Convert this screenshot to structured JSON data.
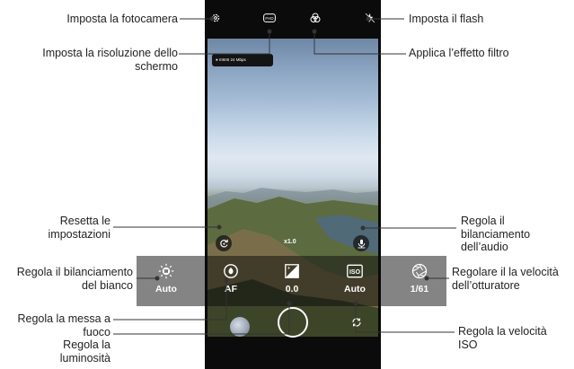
{
  "callouts": {
    "imposta_fotocamera": "Imposta la fotocamera",
    "imposta_risoluzione": "Imposta la risoluzione dello schermo",
    "applica_filtro": "Applica l’effetto filtro",
    "imposta_flash": "Imposta il flash",
    "resetta": "Resetta le impostazioni",
    "bilanciamento_audio": "Regola il bilanciamento dell’audio",
    "bilanciamento_bianco": "Regola il bilanciamento del bianco",
    "velocita_otturatore": "Regolare il la velocità dell’otturatore",
    "messa_a_fuoco": "Regola la messa a fuoco",
    "luminosita": "Regola la luminosità",
    "velocita_iso": "Regola la velocità ISO"
  },
  "camera": {
    "resolution_badge": "FHD",
    "status_bar": "● IIIIIIIII 24 Mbps",
    "zoom": "x1.0",
    "panel": [
      {
        "icon": "white-balance-icon",
        "value": "Auto"
      },
      {
        "icon": "focus-icon",
        "value": "AF"
      },
      {
        "icon": "brightness-icon",
        "value": "0.0"
      },
      {
        "icon": "iso-icon",
        "icon_text": "ISO",
        "value": "Auto"
      },
      {
        "icon": "shutter-speed-icon",
        "value": "1/61"
      }
    ]
  },
  "colors": {
    "leader": "#333333",
    "overlay": "#0a0a0a",
    "label_text": "#222222",
    "value_text": "#ffffff"
  }
}
